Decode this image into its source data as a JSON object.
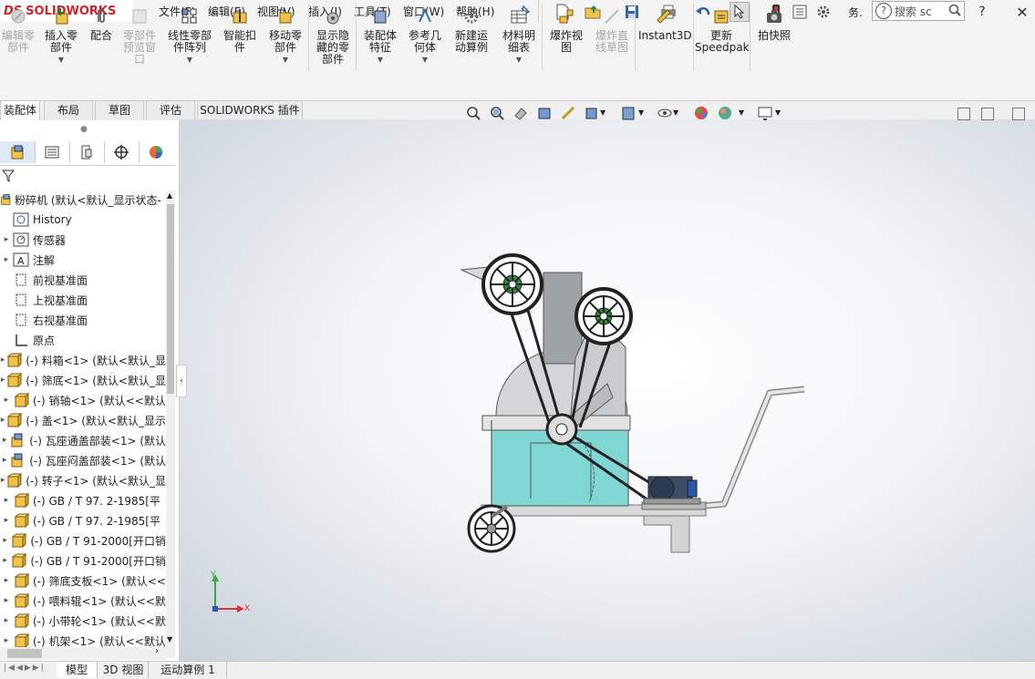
{
  "app": {
    "logo_ds": "DS",
    "logo_name": "SOLIDWORKS"
  },
  "menu": [
    "文件(F)",
    "编辑(E)",
    "视图(V)",
    "插入(I)",
    "工具(T)",
    "窗口(W)",
    "帮助(H)"
  ],
  "search": {
    "placeholder": "搜索 sc"
  },
  "toolbar_abbrev": "务.",
  "command_manager": {
    "buttons": [
      {
        "label": "编辑零\n部件",
        "disabled": true
      },
      {
        "label": "插入零\n部件",
        "disabled": false
      },
      {
        "label": "配合",
        "disabled": false
      },
      {
        "label": "零部件\n预览窗\n口",
        "disabled": true
      },
      {
        "label": "线性零部\n件阵列",
        "disabled": false
      },
      {
        "label": "智能扣\n件",
        "disabled": false
      },
      {
        "label": "移动零\n部件",
        "disabled": false
      },
      {
        "label": "显示隐\n藏的零\n部件",
        "disabled": false
      },
      {
        "label": "装配体\n特征",
        "disabled": false
      },
      {
        "label": "参考几\n何体",
        "disabled": false
      },
      {
        "label": "新建运\n动算例",
        "disabled": false
      },
      {
        "label": "材料明\n细表",
        "disabled": false
      },
      {
        "label": "爆炸视\n图",
        "disabled": false
      },
      {
        "label": "爆炸直\n线草图",
        "disabled": true
      },
      {
        "label": "Instant3D",
        "disabled": false
      },
      {
        "label": "更新\nSpeedpak",
        "disabled": false
      },
      {
        "label": "拍快照",
        "disabled": false
      }
    ]
  },
  "tabs": [
    "装配体",
    "布局",
    "草图",
    "评估",
    "SOLIDWORKS 插件"
  ],
  "active_tab": "装配体",
  "feature_tree": {
    "root": "粉碎机 (默认<默认_显示状态-",
    "items": [
      {
        "label": "History",
        "icon": "history-icon"
      },
      {
        "label": "传感器",
        "icon": "sensor-icon"
      },
      {
        "label": "注解",
        "icon": "annotation-icon"
      },
      {
        "label": "前视基准面",
        "icon": "plane-icon"
      },
      {
        "label": "上视基准面",
        "icon": "plane-icon"
      },
      {
        "label": "右视基准面",
        "icon": "plane-icon"
      },
      {
        "label": "原点",
        "icon": "origin-icon"
      },
      {
        "label": "(-) 料箱<1> (默认<默认_显",
        "icon": "part-icon"
      },
      {
        "label": "(-) 筛底<1> (默认<默认_显",
        "icon": "part-icon"
      },
      {
        "label": "(-) 销轴<1> (默认<<默认",
        "icon": "part-icon"
      },
      {
        "label": "(-) 盖<1> (默认<默认_显示",
        "icon": "part-icon"
      },
      {
        "label": "(-) 瓦座通盖部装<1> (默认",
        "icon": "subassembly-icon"
      },
      {
        "label": "(-) 瓦座闷盖部装<1> (默认",
        "icon": "subassembly-icon"
      },
      {
        "label": "(-) 转子<1> (默认<默认_显",
        "icon": "part-icon"
      },
      {
        "label": "(-) GB / T 97. 2-1985[平",
        "icon": "part-icon"
      },
      {
        "label": "(-) GB / T 97. 2-1985[平",
        "icon": "part-icon"
      },
      {
        "label": "(-) GB / T 91-2000[开口销",
        "icon": "part-icon"
      },
      {
        "label": "(-) GB / T 91-2000[开口销",
        "icon": "part-icon"
      },
      {
        "label": "(-) 筛底支板<1> (默认<<",
        "icon": "part-icon"
      },
      {
        "label": "(-) 喂料辊<1> (默认<<默",
        "icon": "part-icon"
      },
      {
        "label": "(-) 小带轮<1> (默认<<默",
        "icon": "part-icon"
      },
      {
        "label": "(-) 机架<1> (默认<<默认",
        "icon": "part-icon"
      }
    ]
  },
  "bottom_tabs": [
    "模型",
    "3D 视图",
    "运动算例 1"
  ],
  "active_bottom_tab": "模型",
  "triad": {
    "x": "X",
    "y": "Y"
  },
  "colors": {
    "accent": "#d2232a",
    "machine_cyan": "#7fd6d2",
    "machine_grey": "#cfd2d4"
  }
}
